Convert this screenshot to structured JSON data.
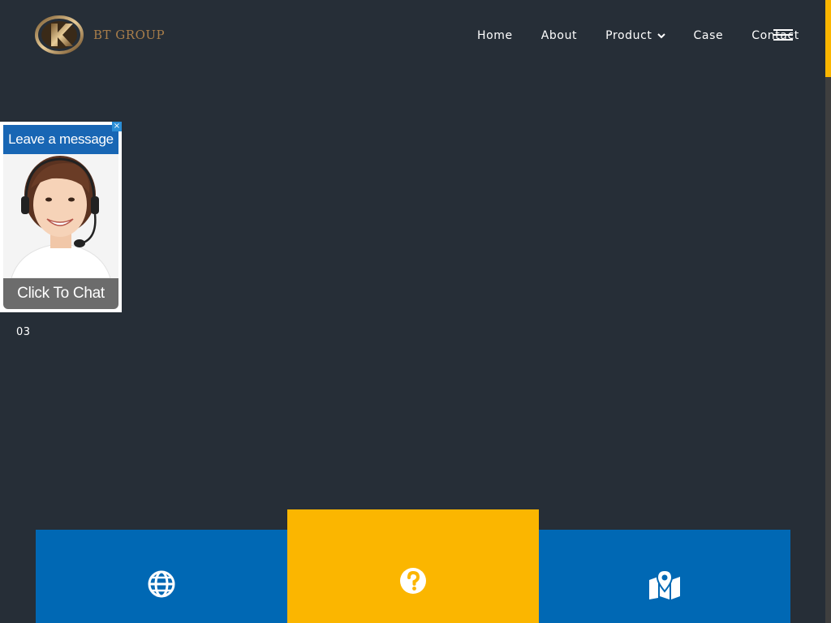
{
  "header": {
    "logo_text": "BT GROUP",
    "nav": [
      {
        "label": "Home"
      },
      {
        "label": "About"
      },
      {
        "label": "Product",
        "has_dropdown": true
      },
      {
        "label": "Case"
      },
      {
        "label": "Contact"
      }
    ],
    "menu_icon": "hamburger-icon"
  },
  "chat_widget": {
    "title": "Leave a message",
    "cta": "Click To Chat",
    "close_symbol": "×"
  },
  "slider": {
    "current_index": "03"
  },
  "features": [
    {
      "icon": "globe-icon"
    },
    {
      "icon": "question-circle-icon"
    },
    {
      "icon": "map-marker-icon"
    }
  ],
  "colors": {
    "background": "#262e37",
    "accent_yellow": "#fbb600",
    "brand_blue": "#0068b4",
    "logo_gold": "#a97e4a"
  }
}
